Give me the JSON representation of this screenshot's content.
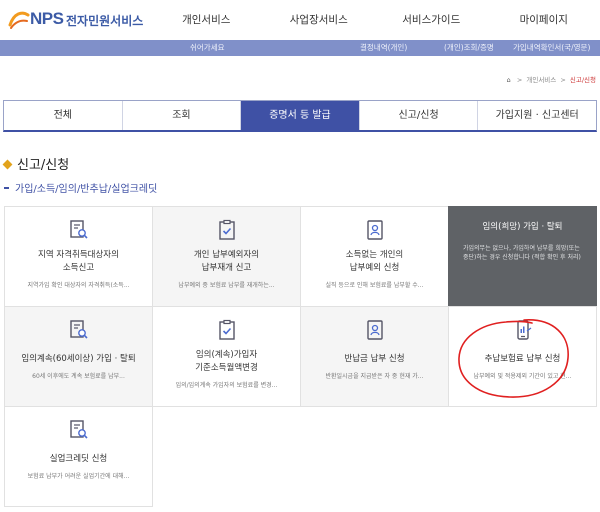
{
  "header": {
    "logo_mark": "NPS",
    "logo_text": "전자민원서비스",
    "nav": [
      "개인서비스",
      "사업장서비스",
      "서비스가이드",
      "마이페이지"
    ]
  },
  "subbar": {
    "greeting": "쉬어가세요",
    "links": [
      "결정내역(개인)",
      "(개인)조회/증명",
      "가입내역확인서(국/영문)"
    ]
  },
  "breadcrumb": {
    "parent": "개인서비스",
    "current": "신고/신청"
  },
  "tabs": [
    {
      "label": "전체",
      "active": false
    },
    {
      "label": "조회",
      "active": false
    },
    {
      "label": "증명서 등 발급",
      "active": true
    },
    {
      "label": "신고/신청",
      "active": false
    },
    {
      "label": "가입지원 · 신고센터",
      "active": false
    }
  ],
  "section": {
    "title": "신고/신청",
    "subtitle": "가입/소득/임의/반추납/실업크레딧"
  },
  "cards": [
    {
      "icon": "document-search-icon",
      "title_lines": [
        "지역 자격취득대상자의",
        "소득신고"
      ],
      "desc": "지역가입 확인 대상자의 자격취득(소득..."
    },
    {
      "icon": "clipboard-check-icon",
      "title_lines": [
        "개인 납부예외자의",
        "납부재개 신고"
      ],
      "desc": "납부예외 중 보험료 납부를 재개하는..."
    },
    {
      "icon": "person-id-icon",
      "title_lines": [
        "소득없는 개인의",
        "납부예외 신청"
      ],
      "desc": "실직 등으로 인해 보험료를 납부할 수..."
    },
    {
      "icon": "",
      "title_lines": [
        "임의(희망) 가입 · 탈퇴"
      ],
      "desc": "가입의무는 없으나, 가입하여 납부를 희망(또는 중단)하는 경우 신청합니다 (적합 확인 후 처리)",
      "dark": true
    },
    {
      "icon": "document-search-icon",
      "title_lines": [
        "임의계속(60세이상) 가입 · 탈퇴"
      ],
      "desc": "60세 이후에도 계속 보험료를 납부..."
    },
    {
      "icon": "clipboard-check-icon",
      "title_lines": [
        "임의(계속)가입자",
        "기준소득월액변경"
      ],
      "desc": "임의/임의계속 가입자의 보험료를 변경..."
    },
    {
      "icon": "person-id-icon",
      "title_lines": [
        "반납금 납부 신청"
      ],
      "desc": "반환일시금을 지급받은 자 중 현재 가..."
    },
    {
      "icon": "mobile-chart-icon",
      "title_lines": [
        "추납보험료 납부 신청"
      ],
      "desc": "납부예외 및 적용제외 기간이 있고 현..."
    },
    {
      "icon": "document-search-icon",
      "title_lines": [
        "실업크레딧 신청"
      ],
      "desc": "보험료 납부가 어려운 실업기간에 대해..."
    }
  ],
  "colors": {
    "brand": "#3c5ba6",
    "subbar": "#8090c9",
    "tab_active": "#3f51a5",
    "accent_diamond": "#e2a31c",
    "card_dark": "#5f6266",
    "annotation": "#e02020"
  }
}
